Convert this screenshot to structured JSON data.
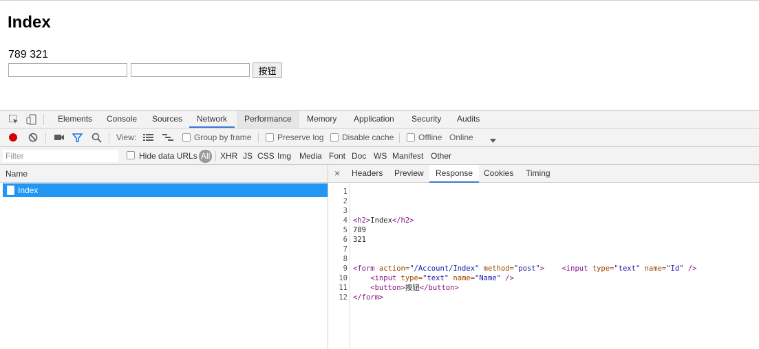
{
  "page": {
    "title": "Index",
    "values": "789 321",
    "button_label": "按钮"
  },
  "devtools": {
    "tabs": [
      "Elements",
      "Console",
      "Sources",
      "Network",
      "Performance",
      "Memory",
      "Application",
      "Security",
      "Audits"
    ],
    "active_tab": "Network",
    "toolbar": {
      "view_label": "View:",
      "group_by_frame": "Group by frame",
      "preserve_log": "Preserve log",
      "disable_cache": "Disable cache",
      "offline": "Offline",
      "throttle": "Online"
    },
    "filter": {
      "placeholder": "Filter",
      "hide_data_urls": "Hide data URLs",
      "types": [
        "All",
        "XHR",
        "JS",
        "CSS",
        "Img",
        "Media",
        "Font",
        "Doc",
        "WS",
        "Manifest",
        "Other"
      ]
    },
    "requests": {
      "header": "Name",
      "rows": [
        {
          "name": "Index"
        }
      ]
    },
    "detail": {
      "close": "×",
      "tabs": [
        "Headers",
        "Preview",
        "Response",
        "Cookies",
        "Timing"
      ],
      "active_tab": "Response",
      "line_numbers": [
        "1",
        "2",
        "3",
        "4",
        "5",
        "6",
        "7",
        "8",
        "9",
        "10",
        "11",
        "12"
      ],
      "code": {
        "h2_open": "<h2>",
        "h2_text": "Index",
        "h2_close": "</h2>",
        "line5": "789",
        "line6": "321",
        "form_open": "<form",
        "attr_action": " action=",
        "val_action": "\"/Account/Index\"",
        "attr_method": " method=",
        "val_method": "\"post\"",
        "form_gt": ">",
        "input_open": "    <input",
        "attr_type": " type=",
        "val_text": "\"text\"",
        "attr_name": " name=",
        "val_id": "\"Id\"",
        "self_close": " />",
        "line10_indent": "    <input",
        "val_name": "\"Name\"",
        "button_open": "    <button>",
        "button_text": "按钮",
        "button_close": "</button>",
        "form_close": "</form>"
      }
    },
    "colors": {
      "accent": "#3879d9",
      "selected_row": "#2196f3",
      "record": "#d50000"
    }
  }
}
